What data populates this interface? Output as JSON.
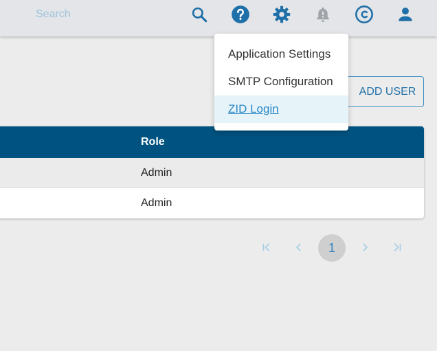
{
  "header": {
    "search_placeholder": "Search",
    "icons": [
      "search-icon",
      "help-icon",
      "settings-icon",
      "notifications-icon",
      "copyright-icon",
      "account-icon"
    ]
  },
  "menu": {
    "items": [
      {
        "label": "Application Settings"
      },
      {
        "label": "SMTP Configuration"
      },
      {
        "label": "ZID Login",
        "active": true
      }
    ]
  },
  "actions": {
    "add_user_label": "ADD USER"
  },
  "table": {
    "columns": [
      "Role"
    ],
    "rows": [
      {
        "role": "Admin"
      },
      {
        "role": "Admin"
      }
    ]
  },
  "pagination": {
    "current_page": "1",
    "first_glyph": "|‹",
    "prev_glyph": "‹",
    "next_glyph": "›",
    "last_glyph": "›|"
  },
  "colors": {
    "header_bg": "#e3e5e8",
    "accent": "#1f6fa8",
    "table_header_bg": "#005380",
    "menu_active_bg": "#e6f4fa"
  }
}
